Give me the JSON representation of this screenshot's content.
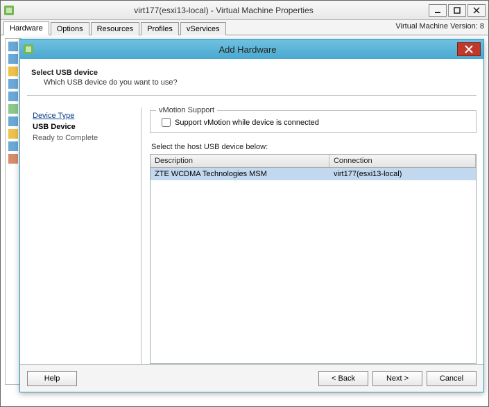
{
  "parent": {
    "title": "virt177(esxi13-local) - Virtual Machine Properties",
    "tabs": [
      "Hardware",
      "Options",
      "Resources",
      "Profiles",
      "vServices"
    ],
    "active_tab": 0,
    "version_label": "Virtual Machine Version: 8"
  },
  "dialog": {
    "title": "Add Hardware",
    "step_title": "Select USB device",
    "step_sub": "Which USB device do you want to use?",
    "nav": {
      "items": [
        {
          "label": "Device Type",
          "state": "link"
        },
        {
          "label": "USB Device",
          "state": "current"
        },
        {
          "label": "Ready to Complete",
          "state": "pending"
        }
      ]
    },
    "vmotion_group": "vMotion Support",
    "vmotion_label": "Support vMotion while device is connected",
    "vmotion_checked": false,
    "list_label": "Select the host USB device below:",
    "columns": {
      "c1": "Description",
      "c2": "Connection"
    },
    "rows": [
      {
        "desc": "ZTE WCDMA Technologies MSM",
        "conn": "virt177(esxi13-local)",
        "selected": true
      }
    ],
    "buttons": {
      "help": "Help",
      "back": "< Back",
      "next": "Next >",
      "cancel": "Cancel"
    }
  }
}
